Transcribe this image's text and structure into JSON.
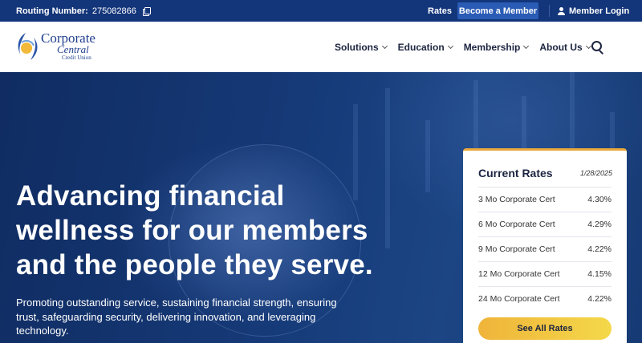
{
  "topbar": {
    "routing_label": "Routing Number:",
    "routing_value": "275082866",
    "rates_link": "Rates",
    "become_member": "Become a Member",
    "member_login": "Member Login"
  },
  "logo": {
    "line1": "Corporate",
    "line2": "Central",
    "line3": "Credit Union"
  },
  "nav": {
    "items": [
      {
        "label": "Solutions"
      },
      {
        "label": "Education"
      },
      {
        "label": "Membership"
      },
      {
        "label": "About Us"
      }
    ]
  },
  "hero": {
    "headline": "Advancing financial wellness for our members and the people they serve.",
    "subtext": "Promoting outstanding service, sustaining financial strength, ensuring trust, safeguarding security, delivering innovation, and leveraging technology."
  },
  "rates_card": {
    "title": "Current Rates",
    "date": "1/28/2025",
    "rows": [
      {
        "name": "3 Mo Corporate Cert",
        "rate": "4.30%"
      },
      {
        "name": "6 Mo Corporate Cert",
        "rate": "4.29%"
      },
      {
        "name": "9 Mo Corporate Cert",
        "rate": "4.22%"
      },
      {
        "name": "12 Mo Corporate Cert",
        "rate": "4.15%"
      },
      {
        "name": "24 Mo Corporate Cert",
        "rate": "4.22%"
      }
    ],
    "button": "See All Rates"
  },
  "colors": {
    "topbar": "#13357a",
    "accent_button": "#2a5bb5",
    "rates_button": "#efb43a",
    "brand_text": "#1f3f8f"
  }
}
